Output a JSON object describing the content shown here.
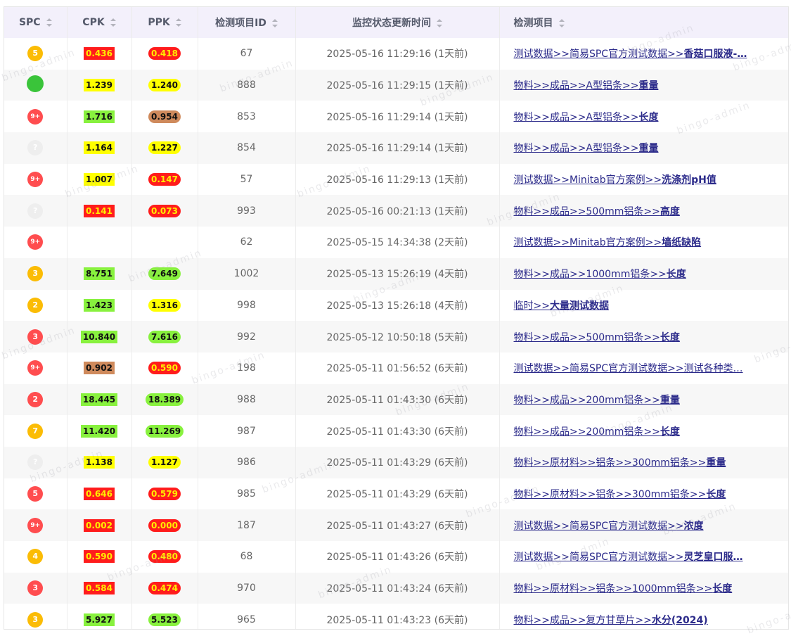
{
  "columns": {
    "spc": "SPC",
    "cpk": "CPK",
    "ppk": "PPK",
    "id": "检测项目ID",
    "time": "监控状态更新时间",
    "item": "检测项目"
  },
  "watermark": "bingo-admin",
  "colors": {
    "spc_red": "#ff4d4f",
    "spc_yellow": "#fbbc05",
    "spc_green": "#3ac43a",
    "spc_gray": "#eeeeee",
    "cpk_red": "#ff1c1c",
    "cpk_yellow": "#ffff00",
    "cpk_green": "#88f13e",
    "cpk_orange": "#cf8a5c"
  },
  "rows": [
    {
      "spc": "5",
      "spc_color": "yellow",
      "cpk": "0.436",
      "cpk_level": "red",
      "ppk": "0.418",
      "ppk_level": "red",
      "id": "67",
      "time": "2025-05-16 11:29:16 (1天前)",
      "item_prefix": "测试数据>>简易SPC官方测试数据>>",
      "item_bold": "香菇口服液-…"
    },
    {
      "spc": "",
      "spc_color": "green",
      "cpk": "1.239",
      "cpk_level": "yellow",
      "ppk": "1.240",
      "ppk_level": "yellow",
      "id": "888",
      "time": "2025-05-16 11:29:15 (1天前)",
      "item_prefix": "物料>>成品>>A型铝条>>",
      "item_bold": "重量"
    },
    {
      "spc": "9+",
      "spc_color": "red",
      "cpk": "1.716",
      "cpk_level": "green",
      "ppk": "0.954",
      "ppk_level": "orange",
      "id": "853",
      "time": "2025-05-16 11:29:14 (1天前)",
      "item_prefix": "物料>>成品>>A型铝条>>",
      "item_bold": "长度"
    },
    {
      "spc": "?",
      "spc_color": "gray",
      "cpk": "1.164",
      "cpk_level": "yellow",
      "ppk": "1.227",
      "ppk_level": "yellow",
      "id": "854",
      "time": "2025-05-16 11:29:14 (1天前)",
      "item_prefix": "物料>>成品>>A型铝条>>",
      "item_bold": "重量"
    },
    {
      "spc": "9+",
      "spc_color": "red",
      "cpk": "1.007",
      "cpk_level": "yellow",
      "ppk": "0.147",
      "ppk_level": "red",
      "id": "57",
      "time": "2025-05-16 11:29:13 (1天前)",
      "item_prefix": "测试数据>>Minitab官方案例>>",
      "item_bold": "洗涤剂pH值"
    },
    {
      "spc": "?",
      "spc_color": "gray",
      "cpk": "0.141",
      "cpk_level": "red",
      "ppk": "0.073",
      "ppk_level": "red",
      "id": "993",
      "time": "2025-05-16 00:21:13 (1天前)",
      "item_prefix": "物料>>成品>>500mm铝条>>",
      "item_bold": "高度"
    },
    {
      "spc": "9+",
      "spc_color": "red",
      "cpk": "",
      "cpk_level": "none",
      "ppk": "",
      "ppk_level": "none",
      "id": "62",
      "time": "2025-05-15 14:34:38 (2天前)",
      "item_prefix": "测试数据>>Minitab官方案例>>",
      "item_bold": "墙纸缺陷"
    },
    {
      "spc": "3",
      "spc_color": "yellow",
      "cpk": "8.751",
      "cpk_level": "green",
      "ppk": "7.649",
      "ppk_level": "green",
      "id": "1002",
      "time": "2025-05-13 15:26:19 (4天前)",
      "item_prefix": "物料>>成品>>1000mm铝条>>",
      "item_bold": "长度"
    },
    {
      "spc": "2",
      "spc_color": "yellow",
      "cpk": "1.423",
      "cpk_level": "green",
      "ppk": "1.316",
      "ppk_level": "yellow",
      "id": "998",
      "time": "2025-05-13 15:26:18 (4天前)",
      "item_prefix": "临时>>",
      "item_bold": "大量测试数据"
    },
    {
      "spc": "3",
      "spc_color": "red",
      "cpk": "10.840",
      "cpk_level": "green",
      "ppk": "7.616",
      "ppk_level": "green",
      "id": "992",
      "time": "2025-05-12 10:50:18 (5天前)",
      "item_prefix": "物料>>成品>>500mm铝条>>",
      "item_bold": "长度"
    },
    {
      "spc": "9+",
      "spc_color": "red",
      "cpk": "0.902",
      "cpk_level": "orange",
      "ppk": "0.590",
      "ppk_level": "red",
      "id": "198",
      "time": "2025-05-11 01:56:52 (6天前)",
      "item_prefix": "测试数据>>简易SPC官方测试数据>>测试各种类…",
      "item_bold": ""
    },
    {
      "spc": "2",
      "spc_color": "red",
      "cpk": "18.445",
      "cpk_level": "green",
      "ppk": "18.389",
      "ppk_level": "green",
      "id": "988",
      "time": "2025-05-11 01:43:30 (6天前)",
      "item_prefix": "物料>>成品>>200mm铝条>>",
      "item_bold": "重量"
    },
    {
      "spc": "7",
      "spc_color": "yellow",
      "cpk": "11.420",
      "cpk_level": "green",
      "ppk": "11.269",
      "ppk_level": "green",
      "id": "987",
      "time": "2025-05-11 01:43:30 (6天前)",
      "item_prefix": "物料>>成品>>200mm铝条>>",
      "item_bold": "长度"
    },
    {
      "spc": "?",
      "spc_color": "gray",
      "cpk": "1.138",
      "cpk_level": "yellow",
      "ppk": "1.127",
      "ppk_level": "yellow",
      "id": "986",
      "time": "2025-05-11 01:43:29 (6天前)",
      "item_prefix": "物料>>原材料>>铝条>>300mm铝条>>",
      "item_bold": "重量"
    },
    {
      "spc": "5",
      "spc_color": "red",
      "cpk": "0.646",
      "cpk_level": "red",
      "ppk": "0.579",
      "ppk_level": "red",
      "id": "985",
      "time": "2025-05-11 01:43:29 (6天前)",
      "item_prefix": "物料>>原材料>>铝条>>300mm铝条>>",
      "item_bold": "长度"
    },
    {
      "spc": "9+",
      "spc_color": "red",
      "cpk": "0.002",
      "cpk_level": "red",
      "ppk": "0.000",
      "ppk_level": "red",
      "id": "187",
      "time": "2025-05-11 01:43:27 (6天前)",
      "item_prefix": "测试数据>>简易SPC官方测试数据>>",
      "item_bold": "浓度"
    },
    {
      "spc": "4",
      "spc_color": "yellow",
      "cpk": "0.590",
      "cpk_level": "red",
      "ppk": "0.480",
      "ppk_level": "red",
      "id": "68",
      "time": "2025-05-11 01:43:26 (6天前)",
      "item_prefix": "测试数据>>简易SPC官方测试数据>>",
      "item_bold": "灵芝皇口服…"
    },
    {
      "spc": "3",
      "spc_color": "red",
      "cpk": "0.584",
      "cpk_level": "red",
      "ppk": "0.474",
      "ppk_level": "red",
      "id": "970",
      "time": "2025-05-11 01:43:24 (6天前)",
      "item_prefix": "物料>>原材料>>铝条>>1000mm铝条>>",
      "item_bold": "长度"
    },
    {
      "spc": "3",
      "spc_color": "yellow",
      "cpk": "5.927",
      "cpk_level": "green",
      "ppk": "5.523",
      "ppk_level": "green",
      "id": "965",
      "time": "2025-05-11 01:43:23 (6天前)",
      "item_prefix": "物料>>成品>>复方甘草片>>",
      "item_bold": "水分(2024)"
    }
  ]
}
